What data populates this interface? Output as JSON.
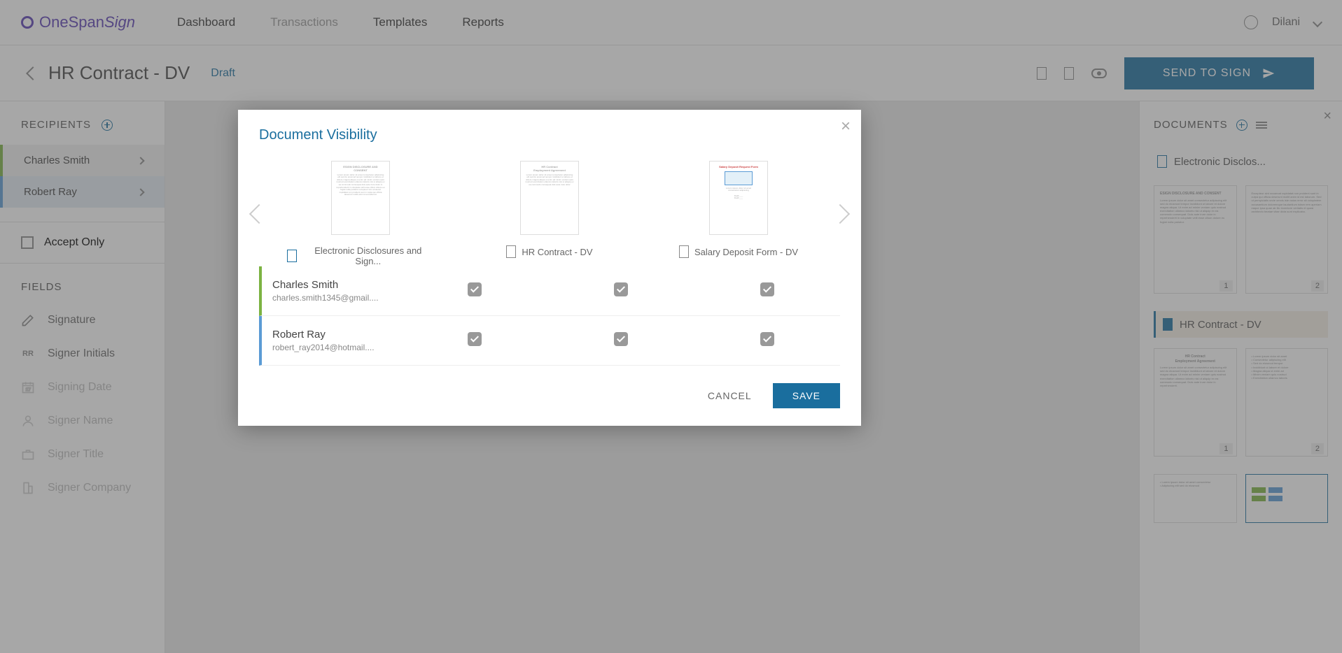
{
  "header": {
    "logo_text": "OneSpan",
    "logo_sign": "Sign",
    "nav": [
      "Dashboard",
      "Transactions",
      "Templates",
      "Reports"
    ],
    "active_nav_index": 1,
    "user_name": "Dilani"
  },
  "subheader": {
    "title": "HR Contract - DV",
    "status": "Draft",
    "send_button": "SEND TO SIGN"
  },
  "left_panel": {
    "recipients_title": "RECIPIENTS",
    "recipients": [
      {
        "name": "Charles Smith",
        "color": "green"
      },
      {
        "name": "Robert Ray",
        "color": "blue"
      }
    ],
    "accept_only": "Accept Only",
    "fields_title": "FIELDS",
    "fields": [
      {
        "icon": "pen",
        "label": "Signature",
        "disabled": false
      },
      {
        "icon": "RR",
        "label": "Signer Initials",
        "disabled": false
      },
      {
        "icon": "date",
        "label": "Signing Date",
        "disabled": true
      },
      {
        "icon": "person",
        "label": "Signer Name",
        "disabled": true
      },
      {
        "icon": "title",
        "label": "Signer Title",
        "disabled": true
      },
      {
        "icon": "company",
        "label": "Signer Company",
        "disabled": true
      }
    ]
  },
  "right_panel": {
    "title": "DOCUMENTS",
    "documents": [
      {
        "title": "Electronic Disclos...",
        "pages": [
          1,
          2
        ],
        "active": false
      },
      {
        "title": "HR Contract - DV",
        "pages": [
          1,
          2
        ],
        "active": true
      }
    ]
  },
  "modal": {
    "title": "Document Visibility",
    "documents": [
      {
        "label": "Electronic Disclosures and Sign...",
        "icon": "blue"
      },
      {
        "label": "HR Contract - DV",
        "icon": "gray"
      },
      {
        "label": "Salary Deposit Form - DV",
        "icon": "gray"
      }
    ],
    "recipients": [
      {
        "name": "Charles Smith",
        "email": "charles.smith1345@gmail....",
        "color": "green",
        "checks": [
          true,
          true,
          true
        ]
      },
      {
        "name": "Robert Ray",
        "email": "robert_ray2014@hotmail....",
        "color": "blue",
        "checks": [
          true,
          true,
          true
        ]
      }
    ],
    "cancel": "CANCEL",
    "save": "SAVE"
  }
}
